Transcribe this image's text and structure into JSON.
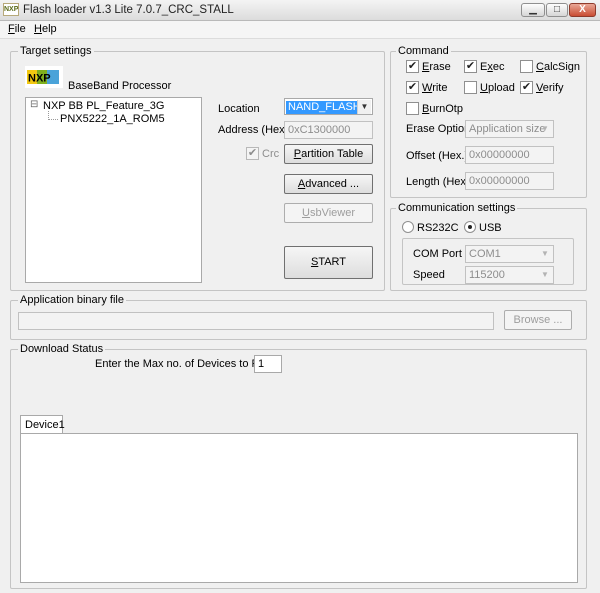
{
  "window": {
    "title": "Flash loader v1.3 Lite 7.0.7_CRC_STALL",
    "icon_text": "NXP",
    "minimize_label": "▁",
    "maximize_label": "□",
    "close_label": "X"
  },
  "menu": {
    "file_hotkey": "F",
    "file_rest": "ile",
    "help_hotkey": "H",
    "help_rest": "elp"
  },
  "target_settings": {
    "group_label": "Target settings",
    "logo_text": "NXP",
    "processor_label": "BaseBand Processor",
    "tree": {
      "root_toggle": "⊟",
      "root_label": "NXP BB PL_Feature_3G",
      "child_label": "PNX5222_1A_ROM5"
    },
    "location_label": "Location",
    "location_value": "NAND_FLASH",
    "address_label": "Address (Hex.)",
    "address_value": "0xC1300000",
    "crc_label": "Crc",
    "crc_checked": "✔",
    "partition_table_hotkey": "P",
    "partition_table_rest": "artition Table",
    "advanced_hotkey": "A",
    "advanced_rest": "dvanced ...",
    "usbviewer_hotkey": "U",
    "usbviewer_rest": "sbViewer",
    "start_hotkey": "S",
    "start_rest": "TART"
  },
  "command": {
    "group_label": "Command",
    "erase": {
      "hotkey": "E",
      "rest": "rase",
      "mark": "✔"
    },
    "exec": {
      "pre": "E",
      "hotkey": "x",
      "rest": "ec",
      "mark": "✔"
    },
    "calcsign": {
      "hotkey": "C",
      "rest": "alcSign",
      "mark": ""
    },
    "write": {
      "hotkey": "W",
      "rest": "rite",
      "mark": "✔"
    },
    "upload": {
      "hotkey": "U",
      "rest": "pload",
      "mark": ""
    },
    "verify": {
      "hotkey": "V",
      "rest": "erify",
      "mark": "✔"
    },
    "burnotp": {
      "hotkey": "B",
      "rest": "urnOtp",
      "mark": ""
    },
    "erase_option_label": "Erase Option",
    "erase_option_value": "Application size",
    "offset_label": "Offset (Hex.)",
    "offset_value": "0x00000000",
    "length_label": "Length (Hex.)",
    "length_value": "0x00000000"
  },
  "communication": {
    "group_label": "Communication settings",
    "rs232c_label": "RS232C",
    "usb_label": "USB",
    "selected": "USB",
    "com_port_label": "COM Port",
    "com_port_value": "COM1",
    "speed_label": "Speed",
    "speed_value": "115200"
  },
  "application_binary": {
    "group_label": "Application binary file",
    "path_value": "",
    "browse_label": "Browse ..."
  },
  "download_status": {
    "group_label": "Download Status",
    "max_devices_label": "Enter the Max no. of Devices to Flash:",
    "max_devices_value": "1",
    "tab_label": "Device1"
  },
  "colors": {
    "selection": "#3399ff",
    "title_gradient_top": "#f4f4f4",
    "close_button": "#c94d33"
  },
  "icons": [
    "app-icon",
    "nxp-logo",
    "tree-expand-icon",
    "combo-arrow-icon",
    "check-icon"
  ]
}
